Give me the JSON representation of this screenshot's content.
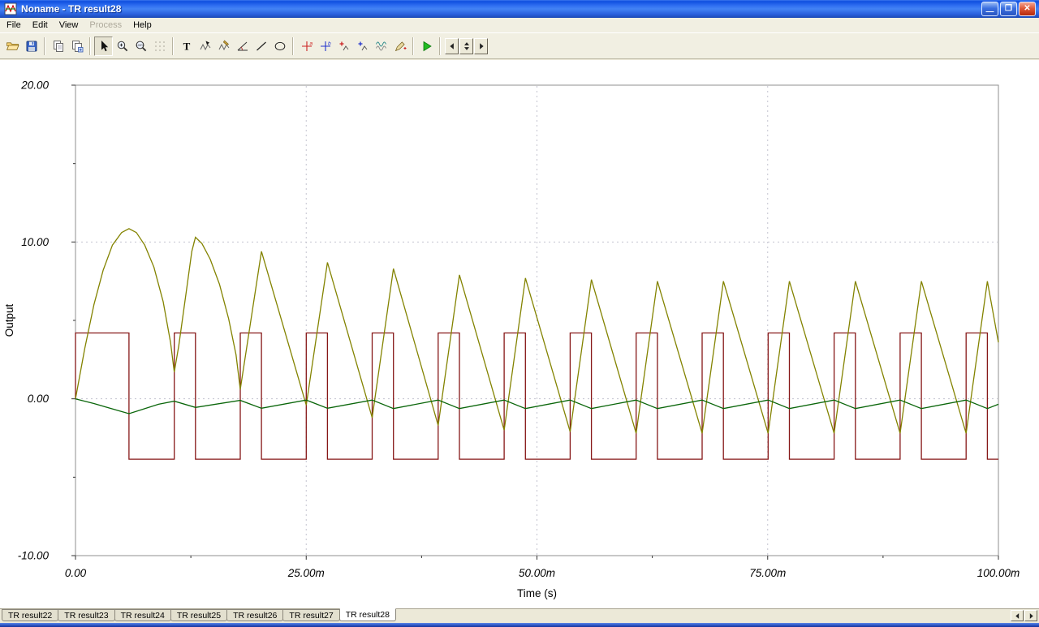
{
  "window": {
    "title": "Noname - TR result28",
    "controls": {
      "minimize": "—",
      "maximize": "❐",
      "close": "✕"
    }
  },
  "menu": {
    "items": [
      {
        "label": "File",
        "enabled": true
      },
      {
        "label": "Edit",
        "enabled": true
      },
      {
        "label": "View",
        "enabled": true
      },
      {
        "label": "Process",
        "enabled": false
      },
      {
        "label": "Help",
        "enabled": true
      }
    ]
  },
  "toolbar": {
    "buttons": [
      "open",
      "save",
      "copy",
      "copy-special",
      "select-cursor",
      "zoom-in",
      "zoom-100",
      "grid",
      "text-tool",
      "select-curve",
      "edit-curve",
      "slope-tool",
      "line-tool",
      "ellipse-tool",
      "cursor-a",
      "cursor-b",
      "add-marker-a",
      "add-marker-b",
      "show-curves",
      "annotate-pen",
      "run",
      "page-prev",
      "page-spinner",
      "page-next"
    ],
    "active_tool": "select-cursor"
  },
  "tabs": {
    "items": [
      {
        "label": "TR result22",
        "active": false
      },
      {
        "label": "TR result23",
        "active": false
      },
      {
        "label": "TR result24",
        "active": false
      },
      {
        "label": "TR result25",
        "active": false
      },
      {
        "label": "TR result26",
        "active": false
      },
      {
        "label": "TR result27",
        "active": false
      },
      {
        "label": "TR result28",
        "active": true
      }
    ]
  },
  "chart_data": {
    "type": "line",
    "title": "",
    "xlabel": "Time (s)",
    "ylabel": "Output",
    "x_unit": "ms",
    "xlim": [
      0,
      100
    ],
    "ylim": [
      -10,
      20
    ],
    "x_ticks": [
      {
        "v": 0,
        "label": "0.00"
      },
      {
        "v": 25,
        "label": "25.00m"
      },
      {
        "v": 50,
        "label": "50.00m"
      },
      {
        "v": 75,
        "label": "75.00m"
      },
      {
        "v": 100,
        "label": "100.00m"
      }
    ],
    "x_minor": [
      12.5,
      37.5,
      62.5,
      87.5
    ],
    "y_ticks": [
      {
        "v": 20,
        "label": "20.00"
      },
      {
        "v": 10,
        "label": "10.00"
      },
      {
        "v": 0,
        "label": "0.00"
      },
      {
        "v": -10,
        "label": "-10.00"
      }
    ],
    "y_minor": [
      15,
      5,
      -5
    ],
    "grid": {
      "x_values": [
        25,
        50,
        75
      ],
      "y_values": [
        10,
        0
      ],
      "style": "dashed",
      "color": "#c3c3cf"
    },
    "legend": "none",
    "series": [
      {
        "name": "square-wave-darkred",
        "color": "#861717",
        "type": "step",
        "high": 4.2,
        "low": -3.85,
        "start_level": "high",
        "start_at_zero": true,
        "t_end": 100,
        "transitions": [
          0,
          5.8,
          10.7,
          13.0,
          17.85,
          20.15,
          25.0,
          27.3,
          32.15,
          34.45,
          39.3,
          41.6,
          46.45,
          48.75,
          53.6,
          55.9,
          60.75,
          63.05,
          67.9,
          70.2,
          75.05,
          77.35,
          82.2,
          84.5,
          89.35,
          91.65,
          96.5,
          98.8
        ]
      },
      {
        "name": "decaying-triangle-olive",
        "color": "#838300",
        "type": "poly",
        "points": [
          [
            0,
            0
          ],
          [
            1,
            3.2
          ],
          [
            2,
            6.0
          ],
          [
            3,
            8.2
          ],
          [
            4,
            9.8
          ],
          [
            5,
            10.6
          ],
          [
            5.8,
            10.85
          ],
          [
            6.6,
            10.6
          ],
          [
            7.5,
            9.8
          ],
          [
            8.5,
            8.4
          ],
          [
            9.5,
            6.2
          ],
          [
            10.3,
            3.6
          ],
          [
            10.7,
            1.7
          ],
          [
            11.2,
            3.4
          ],
          [
            12.0,
            6.8
          ],
          [
            12.6,
            9.4
          ],
          [
            13.0,
            10.3
          ],
          [
            13.7,
            9.9
          ],
          [
            14.6,
            8.9
          ],
          [
            15.6,
            7.3
          ],
          [
            16.6,
            5.1
          ],
          [
            17.4,
            2.8
          ],
          [
            17.85,
            0.6
          ],
          [
            20.15,
            9.4
          ],
          [
            25.0,
            -0.4
          ],
          [
            27.3,
            8.7
          ],
          [
            32.15,
            -1.2
          ],
          [
            34.45,
            8.3
          ],
          [
            39.3,
            -1.7
          ],
          [
            41.6,
            7.9
          ],
          [
            46.45,
            -2.0
          ],
          [
            48.75,
            7.7
          ],
          [
            53.6,
            -2.1
          ],
          [
            55.9,
            7.6
          ],
          [
            60.75,
            -2.2
          ],
          [
            63.05,
            7.5
          ],
          [
            67.9,
            -2.2
          ],
          [
            70.2,
            7.5
          ],
          [
            75.05,
            -2.2
          ],
          [
            77.35,
            7.5
          ],
          [
            82.2,
            -2.2
          ],
          [
            84.5,
            7.5
          ],
          [
            89.35,
            -2.2
          ],
          [
            91.65,
            7.5
          ],
          [
            96.5,
            -2.2
          ],
          [
            98.8,
            7.5
          ],
          [
            100,
            3.6
          ]
        ]
      },
      {
        "name": "small-ripple-green",
        "color": "#0a660a",
        "type": "poly",
        "points": [
          [
            0,
            0
          ],
          [
            2,
            -0.3
          ],
          [
            5.8,
            -0.95
          ],
          [
            9,
            -0.35
          ],
          [
            10.7,
            -0.15
          ],
          [
            13.0,
            -0.55
          ],
          [
            17.85,
            -0.1
          ],
          [
            20.15,
            -0.6
          ],
          [
            25.0,
            -0.08
          ],
          [
            27.3,
            -0.6
          ],
          [
            32.15,
            -0.08
          ],
          [
            34.45,
            -0.62
          ],
          [
            39.3,
            -0.08
          ],
          [
            41.6,
            -0.62
          ],
          [
            46.45,
            -0.08
          ],
          [
            48.75,
            -0.62
          ],
          [
            53.6,
            -0.08
          ],
          [
            55.9,
            -0.62
          ],
          [
            60.75,
            -0.08
          ],
          [
            63.05,
            -0.62
          ],
          [
            67.9,
            -0.08
          ],
          [
            70.2,
            -0.62
          ],
          [
            75.05,
            -0.08
          ],
          [
            77.35,
            -0.62
          ],
          [
            82.2,
            -0.08
          ],
          [
            84.5,
            -0.62
          ],
          [
            89.35,
            -0.08
          ],
          [
            91.65,
            -0.62
          ],
          [
            96.5,
            -0.08
          ],
          [
            98.8,
            -0.62
          ],
          [
            100,
            -0.35
          ]
        ]
      }
    ]
  }
}
